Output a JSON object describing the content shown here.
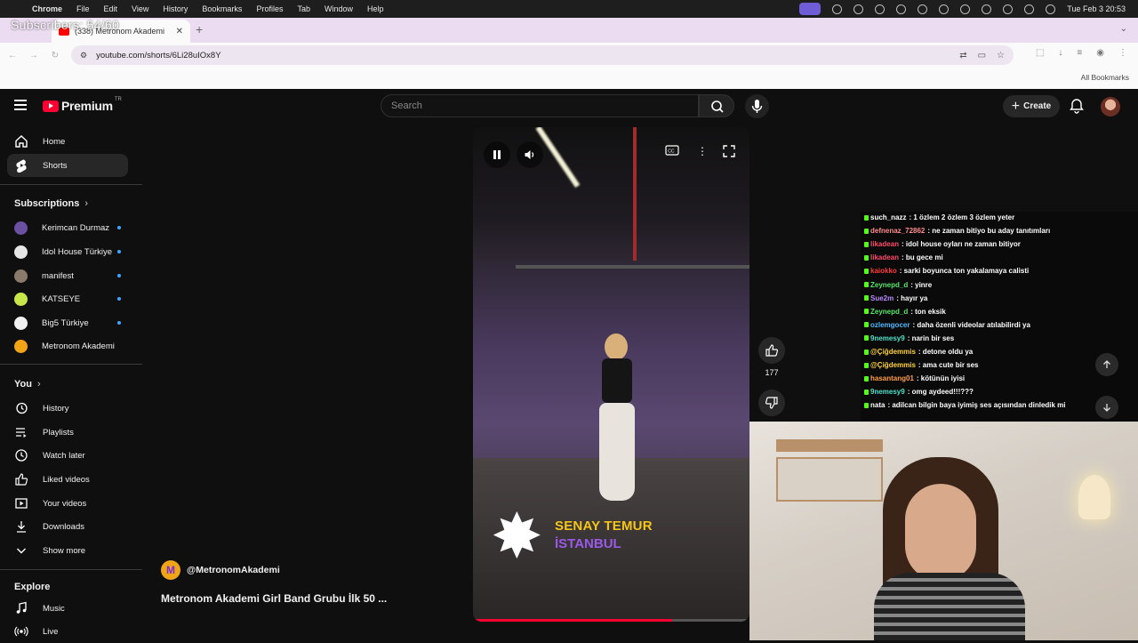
{
  "menubar": {
    "items": [
      "Chrome",
      "File",
      "Edit",
      "View",
      "History",
      "Bookmarks",
      "Profiles",
      "Tab",
      "Window",
      "Help"
    ],
    "clock": "Tue Feb 3  20:53"
  },
  "overlay_text": "Subscribers: 54/60",
  "tab": {
    "title": "(338) Metronom Akademi"
  },
  "address": {
    "url": "youtube.com/shorts/6Li28uIOx8Y"
  },
  "bookmarks": {
    "all_label": "All Bookmarks"
  },
  "header": {
    "brand": "Premium",
    "region": "TR",
    "search_placeholder": "Search",
    "create_label": "Create"
  },
  "sidebar": {
    "primary": [
      {
        "label": "Home"
      },
      {
        "label": "Shorts"
      }
    ],
    "subscriptions_title": "Subscriptions",
    "subscriptions": [
      {
        "label": "Kerimcan Durmaz",
        "color": "#6b4fa0"
      },
      {
        "label": "Idol House Türkiye",
        "color": "#e6e6e6"
      },
      {
        "label": "manifest",
        "color": "#8a7a6a"
      },
      {
        "label": "KATSEYE",
        "color": "#c8e64a"
      },
      {
        "label": "Big5 Türkiye",
        "color": "#f1f1f1"
      },
      {
        "label": "Metronom Akademi",
        "color": "#f2a417"
      }
    ],
    "you_title": "You",
    "you": [
      {
        "label": "History"
      },
      {
        "label": "Playlists"
      },
      {
        "label": "Watch later"
      },
      {
        "label": "Liked videos"
      },
      {
        "label": "Your videos"
      },
      {
        "label": "Downloads"
      },
      {
        "label": "Show more"
      }
    ],
    "explore_title": "Explore",
    "explore": [
      {
        "label": "Music"
      },
      {
        "label": "Live"
      }
    ]
  },
  "video": {
    "caption_line1": "SENAY TEMUR",
    "caption_line2": "İSTANBUL",
    "progress": 0.72,
    "channel": "@MetronomAkademi",
    "channel_initial": "M",
    "title": "Metronom Akademi Girl Band Grubu İlk 50 ..."
  },
  "actions": {
    "like_count": "177"
  },
  "chat": {
    "messages": [
      {
        "user": "such_nazz",
        "text": ": 1 özlem 2 özlem 3 özlem yeter",
        "color": "#ffffff"
      },
      {
        "user": "defnenaz_72862",
        "text": ": ne zaman bitiyo bu aday tanıtımları",
        "color": "#ff8c8c"
      },
      {
        "user": "likadean",
        "text": ": idol house oyları ne zaman bitiyor",
        "color": "#ff4c6a"
      },
      {
        "user": "likadean",
        "text": ": bu gece mi",
        "color": "#ff4c6a"
      },
      {
        "user": "kaiokko",
        "text": ": sarki boyunca ton yakalamaya calisti",
        "color": "#ff3b3b"
      },
      {
        "user": "Zeynepd_d",
        "text": ": yinre",
        "color": "#57e66a"
      },
      {
        "user": "Sue2m",
        "text": ": hayır ya",
        "color": "#b98cff"
      },
      {
        "user": "Zeynepd_d",
        "text": ": ton eksik",
        "color": "#57e66a"
      },
      {
        "user": "ozlemgocer",
        "text": ": daha özenli videolar atılabilirdi ya",
        "color": "#4fb8ff"
      },
      {
        "user": "9nemesy9",
        "text": ": narin bir ses",
        "color": "#4fe0c8"
      },
      {
        "user": "@Çiğdemmis",
        "text": ": detone oldu ya",
        "color": "#ffd23c"
      },
      {
        "user": "@Çiğdemmis",
        "text": ": ama cute bir ses",
        "color": "#ffd23c"
      },
      {
        "user": "hasantang01",
        "text": ": kötünün iyisi",
        "color": "#ff9d4a"
      },
      {
        "user": "9nemesy9",
        "text": ": omg aydeed!!!???",
        "color": "#4fe0c8"
      },
      {
        "user": "nata",
        "text": ": adilcan bilgin baya iyimiş ses açısından dinledik mi",
        "color": "#ffffff"
      }
    ]
  }
}
